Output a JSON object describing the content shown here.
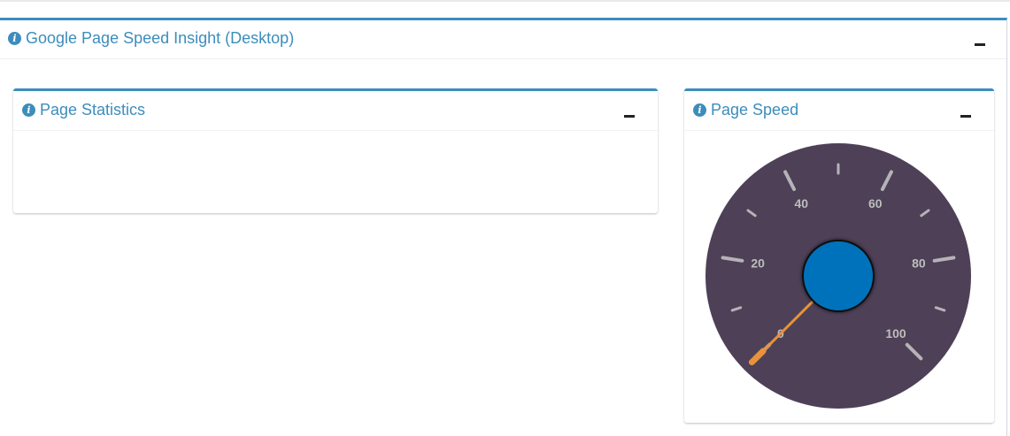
{
  "outer": {
    "title": "Google Page Speed Insight (Desktop)",
    "info_icon": "info-circle-icon",
    "collapse_icon": "minus-icon"
  },
  "stats_box": {
    "title": "Page Statistics",
    "info_icon": "info-circle-icon",
    "collapse_icon": "minus-icon"
  },
  "speed_box": {
    "title": "Page Speed",
    "info_icon": "info-circle-icon",
    "collapse_icon": "minus-icon"
  },
  "gauge": {
    "min": 0,
    "max": 100,
    "value": 0,
    "major_ticks": [
      0,
      20,
      40,
      60,
      80,
      100
    ],
    "labels": [
      "0",
      "20",
      "40",
      "60",
      "80",
      "100"
    ],
    "colors": {
      "face": "#4e4057",
      "hub": "#0072bb",
      "needle": "#e8923a",
      "accent": "#3c8dbc"
    }
  }
}
